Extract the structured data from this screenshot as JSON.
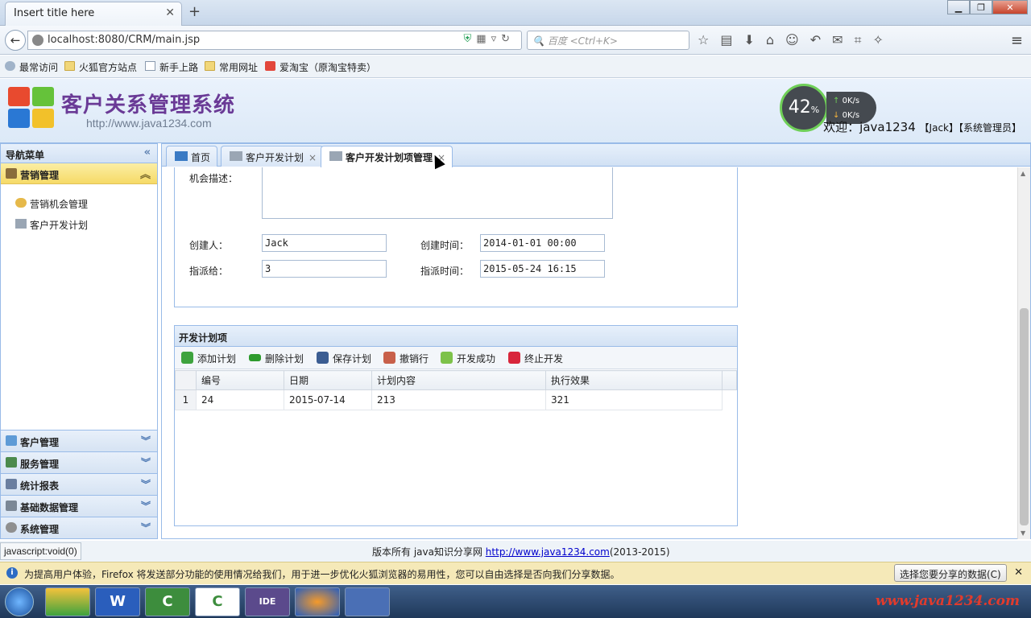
{
  "browser": {
    "tab_title": "Insert title here",
    "new_tab": "+",
    "url": "localhost:8080/CRM/main.jsp",
    "search_placeholder": "百度 <Ctrl+K>",
    "bookmarks": [
      "最常访问",
      "火狐官方站点",
      "新手上路",
      "常用网址",
      "爱淘宝（原淘宝特卖）"
    ]
  },
  "header": {
    "title": "客户关系管理系统",
    "subtitle": "http://www.java1234.com",
    "welcome": "欢迎：java1234",
    "user_tags": "【Jack】【系统管理员】",
    "gauge_value": "42",
    "gauge_unit": "%",
    "speed_up": "0K/s",
    "speed_down": "0K/s"
  },
  "leftnav": {
    "title": "导航菜单",
    "active_section": "营销管理",
    "items": [
      "营销机会管理",
      "客户开发计划"
    ],
    "sections": [
      "客户管理",
      "服务管理",
      "统计报表",
      "基础数据管理",
      "系统管理"
    ]
  },
  "tabs": [
    {
      "label": "首页"
    },
    {
      "label": "客户开发计划"
    },
    {
      "label": "客户开发计划项管理"
    }
  ],
  "form": {
    "desc_label": "机会描述：",
    "creator_label": "创建人：",
    "creator_value": "Jack",
    "create_time_label": "创建时间：",
    "create_time_value": "2014-01-01 00:00",
    "assign_label": "指派给：",
    "assign_value": "3",
    "assign_time_label": "指派时间：",
    "assign_time_value": "2015-05-24 16:15"
  },
  "grid": {
    "title": "开发计划项",
    "toolbar": [
      "添加计划",
      "删除计划",
      "保存计划",
      "撤销行",
      "开发成功",
      "终止开发"
    ],
    "columns": [
      "编号",
      "日期",
      "计划内容",
      "执行效果"
    ],
    "rows": [
      {
        "rn": "1",
        "id": "24",
        "date": "2015-07-14",
        "content": "213",
        "effect": "321"
      }
    ]
  },
  "footer": {
    "status": "javascript:void(0)",
    "copyright_prefix": "版本所有 java知识分享网",
    "copyright_link": "http://www.java1234.com",
    "copyright_suffix": "(2013-2015)"
  },
  "notification": {
    "text": "为提高用户体验，Firefox 将发送部分功能的使用情况给我们，用于进一步优化火狐浏览器的易用性，您可以自由选择是否向我们分享数据。",
    "button": "选择您要分享的数据(C)"
  },
  "taskbar": {
    "watermark": "www.java1234.com"
  }
}
